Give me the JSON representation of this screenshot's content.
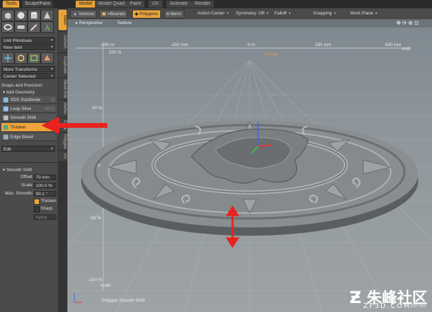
{
  "tool_tabs": [
    "Tools",
    "Sculpt/Paint"
  ],
  "layout_tabs": [
    "Model",
    "Model Quad",
    "Paint",
    "UV",
    "Animate",
    "Render"
  ],
  "toolbar": {
    "vertices": "Vertices",
    "bounds": "+Bounds",
    "polygons": "Polygons",
    "items": "Items",
    "action_center": "Action Center",
    "symmetry": "Symmetry: Off",
    "falloff": "Falloff",
    "snapping": "Snapping",
    "work_plane": "Work Plane"
  },
  "side_tabs": [
    "Basic",
    "Deform",
    "Duplicate",
    "Mesh Edit",
    "Vertex",
    "Edge",
    "Polygon",
    "UV"
  ],
  "left_panel": {
    "unit_primitives": "Unit Primitives",
    "new_item": "New Item",
    "more_transforms": "More Transforms",
    "center_selected": "Center Selected",
    "snaps_precision": "Snaps and Precision",
    "add_geometry": "Add Geometry",
    "tools": [
      {
        "label": "SDS Subdivide",
        "shortcut": "D"
      },
      {
        "label": "Loop Slice",
        "shortcut": "Alt-C"
      },
      {
        "label": "Smooth Shift",
        "shortcut": ""
      },
      {
        "label": "Thicken",
        "shortcut": ""
      },
      {
        "label": "Edge Bevel",
        "shortcut": ""
      }
    ],
    "edit": "Edit"
  },
  "properties": {
    "title": "Smooth Shift",
    "offset_label": "Offset",
    "offset_value": "70 mm",
    "scale_label": "Scale",
    "scale_value": "100.0 %",
    "max_smoothing_label": "Max. Smoothi",
    "max_smoothing_value": "90.1 °",
    "thicken_label": "Thicken",
    "sharp_label": "Sharp",
    "apply_label": "Apply"
  },
  "viewport": {
    "view_label": "Perspective",
    "shading_label": "Texture",
    "ruler_ticks": [
      "-500 m",
      "-250 mm",
      "0 m",
      "250 mm",
      "500 mm"
    ],
    "ruler_top_left": "100 %",
    "ruler_center": "70 mm",
    "ruler_right": "shift",
    "vertical_ticks": [
      "50 %",
      "0",
      "-50 %",
      "-100 %"
    ],
    "scale_label": "scale",
    "status": "Polygon Smooth Shift",
    "corner_info": "200 mm"
  },
  "watermark": {
    "brand": "朱峰社区",
    "site": "ZF3D.COM"
  },
  "colors": {
    "accent": "#e8a33a",
    "annotation_red": "#e8231f"
  }
}
